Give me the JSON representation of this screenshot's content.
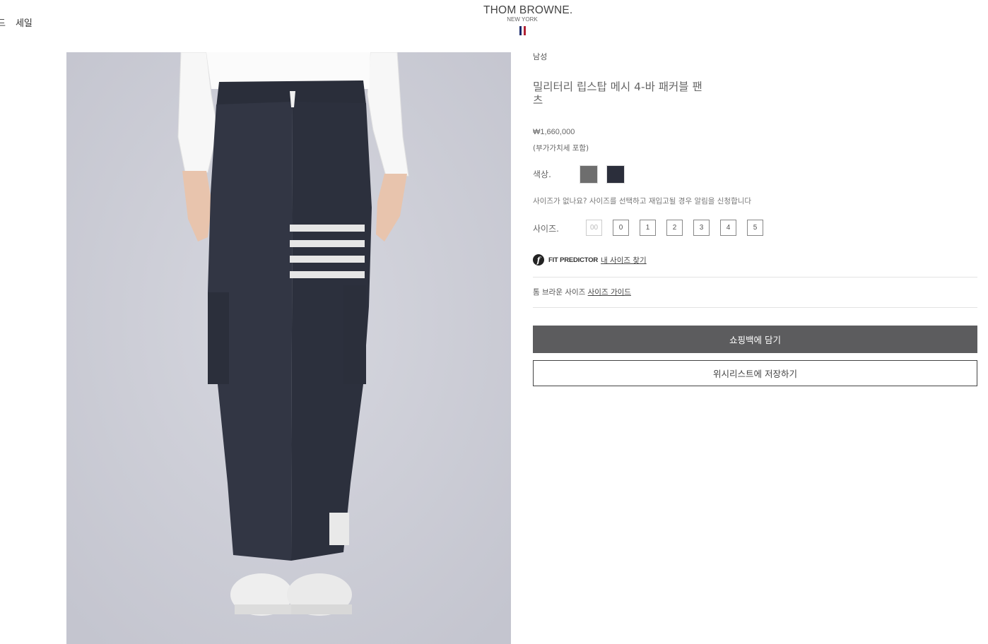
{
  "nav": {
    "item_1": "드",
    "item_2": "세일"
  },
  "logo": {
    "brand": "THOM BROWNE.",
    "city": "NEW YORK"
  },
  "flag_colors": [
    "#1a2a6c",
    "#ffffff",
    "#b22234"
  ],
  "product": {
    "category": "남성",
    "title": "밀리터리 립스탑 메시 4-바 패커블 팬츠",
    "price": "₩1,660,000",
    "vat_note": "(부가가치세 포함)",
    "color_label": "색상.",
    "colors": [
      {
        "name": "grey",
        "hex": "#6e6e6e"
      },
      {
        "name": "navy",
        "hex": "#2b2e3b"
      }
    ],
    "size_notice": "사이즈가 없나요? 사이즈를 선택하고 재입고될 경우 알림을 신청합니다",
    "size_label": "사이즈.",
    "sizes": [
      {
        "label": "00",
        "available": false
      },
      {
        "label": "0",
        "available": true
      },
      {
        "label": "1",
        "available": true
      },
      {
        "label": "2",
        "available": true
      },
      {
        "label": "3",
        "available": true
      },
      {
        "label": "4",
        "available": true
      },
      {
        "label": "5",
        "available": true
      }
    ]
  },
  "fit_predictor": {
    "icon_letter": "f",
    "label": "FIT PREDICTOR",
    "link": "내 사이즈 찾기"
  },
  "size_guide": {
    "prefix": "톰 브라운 사이즈",
    "link": "사이즈 가이드"
  },
  "buttons": {
    "add_to_bag": "쇼핑백에 담기",
    "wishlist": "위시리스트에 저장하기"
  }
}
